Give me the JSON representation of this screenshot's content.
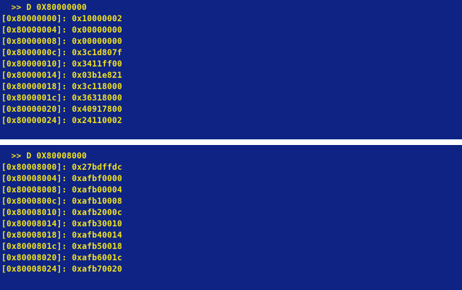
{
  "consoles": [
    {
      "command": ">> D 0X80000000",
      "lines": [
        "[0x80000000]: 0x10000002",
        "[0x80000004]: 0x00000000",
        "[0x80000008]: 0x00000000",
        "[0x8000000c]: 0x3c1d807f",
        "[0x80000010]: 0x3411ff00",
        "[0x80000014]: 0x03b1e821",
        "[0x80000018]: 0x3c118000",
        "[0x8000001c]: 0x36318000",
        "[0x80000020]: 0x40917800",
        "[0x80000024]: 0x24110002"
      ]
    },
    {
      "command": ">> D 0X80008000",
      "lines": [
        "[0x80008000]: 0x27bdffdc",
        "[0x80008004]: 0xafbf0000",
        "[0x80008008]: 0xafb00004",
        "[0x8000800c]: 0xafb10008",
        "[0x80008010]: 0xafb2000c",
        "[0x80008014]: 0xafb30010",
        "[0x80008018]: 0xafb40014",
        "[0x8000801c]: 0xafb50018",
        "[0x80008020]: 0xafb6001c",
        "[0x80008024]: 0xafb70020"
      ]
    }
  ],
  "colors": {
    "background": "#0e2384",
    "text": "#f2e31c",
    "separator": "#ffffff"
  }
}
